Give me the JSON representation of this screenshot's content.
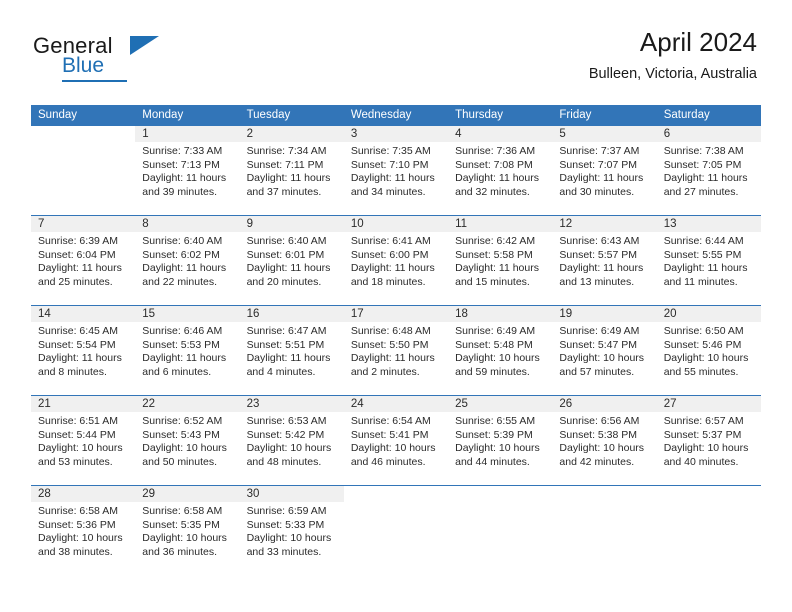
{
  "brand": {
    "line1": "General",
    "line2": "Blue",
    "accent_color": "#1f6fb4",
    "logo_icon": "triangle-flag-icon"
  },
  "header": {
    "title": "April 2024",
    "location": "Bulleen, Victoria, Australia"
  },
  "calendar": {
    "header_color": "#3275b8",
    "daynum_band_color": "#f0f0f0",
    "weekday_headers": [
      "Sunday",
      "Monday",
      "Tuesday",
      "Wednesday",
      "Thursday",
      "Friday",
      "Saturday"
    ],
    "labels": {
      "sunrise": "Sunrise:",
      "sunset": "Sunset:",
      "daylight": "Daylight:"
    },
    "weeks": [
      [
        {
          "day": "",
          "sunrise": "",
          "sunset": "",
          "daylight_line1": "",
          "daylight_line2": "",
          "blank": true
        },
        {
          "day": "1",
          "sunrise": "Sunrise: 7:33 AM",
          "sunset": "Sunset: 7:13 PM",
          "daylight_line1": "Daylight: 11 hours",
          "daylight_line2": "and 39 minutes."
        },
        {
          "day": "2",
          "sunrise": "Sunrise: 7:34 AM",
          "sunset": "Sunset: 7:11 PM",
          "daylight_line1": "Daylight: 11 hours",
          "daylight_line2": "and 37 minutes."
        },
        {
          "day": "3",
          "sunrise": "Sunrise: 7:35 AM",
          "sunset": "Sunset: 7:10 PM",
          "daylight_line1": "Daylight: 11 hours",
          "daylight_line2": "and 34 minutes."
        },
        {
          "day": "4",
          "sunrise": "Sunrise: 7:36 AM",
          "sunset": "Sunset: 7:08 PM",
          "daylight_line1": "Daylight: 11 hours",
          "daylight_line2": "and 32 minutes."
        },
        {
          "day": "5",
          "sunrise": "Sunrise: 7:37 AM",
          "sunset": "Sunset: 7:07 PM",
          "daylight_line1": "Daylight: 11 hours",
          "daylight_line2": "and 30 minutes."
        },
        {
          "day": "6",
          "sunrise": "Sunrise: 7:38 AM",
          "sunset": "Sunset: 7:05 PM",
          "daylight_line1": "Daylight: 11 hours",
          "daylight_line2": "and 27 minutes."
        }
      ],
      [
        {
          "day": "7",
          "sunrise": "Sunrise: 6:39 AM",
          "sunset": "Sunset: 6:04 PM",
          "daylight_line1": "Daylight: 11 hours",
          "daylight_line2": "and 25 minutes."
        },
        {
          "day": "8",
          "sunrise": "Sunrise: 6:40 AM",
          "sunset": "Sunset: 6:02 PM",
          "daylight_line1": "Daylight: 11 hours",
          "daylight_line2": "and 22 minutes."
        },
        {
          "day": "9",
          "sunrise": "Sunrise: 6:40 AM",
          "sunset": "Sunset: 6:01 PM",
          "daylight_line1": "Daylight: 11 hours",
          "daylight_line2": "and 20 minutes."
        },
        {
          "day": "10",
          "sunrise": "Sunrise: 6:41 AM",
          "sunset": "Sunset: 6:00 PM",
          "daylight_line1": "Daylight: 11 hours",
          "daylight_line2": "and 18 minutes."
        },
        {
          "day": "11",
          "sunrise": "Sunrise: 6:42 AM",
          "sunset": "Sunset: 5:58 PM",
          "daylight_line1": "Daylight: 11 hours",
          "daylight_line2": "and 15 minutes."
        },
        {
          "day": "12",
          "sunrise": "Sunrise: 6:43 AM",
          "sunset": "Sunset: 5:57 PM",
          "daylight_line1": "Daylight: 11 hours",
          "daylight_line2": "and 13 minutes."
        },
        {
          "day": "13",
          "sunrise": "Sunrise: 6:44 AM",
          "sunset": "Sunset: 5:55 PM",
          "daylight_line1": "Daylight: 11 hours",
          "daylight_line2": "and 11 minutes."
        }
      ],
      [
        {
          "day": "14",
          "sunrise": "Sunrise: 6:45 AM",
          "sunset": "Sunset: 5:54 PM",
          "daylight_line1": "Daylight: 11 hours",
          "daylight_line2": "and 8 minutes."
        },
        {
          "day": "15",
          "sunrise": "Sunrise: 6:46 AM",
          "sunset": "Sunset: 5:53 PM",
          "daylight_line1": "Daylight: 11 hours",
          "daylight_line2": "and 6 minutes."
        },
        {
          "day": "16",
          "sunrise": "Sunrise: 6:47 AM",
          "sunset": "Sunset: 5:51 PM",
          "daylight_line1": "Daylight: 11 hours",
          "daylight_line2": "and 4 minutes."
        },
        {
          "day": "17",
          "sunrise": "Sunrise: 6:48 AM",
          "sunset": "Sunset: 5:50 PM",
          "daylight_line1": "Daylight: 11 hours",
          "daylight_line2": "and 2 minutes."
        },
        {
          "day": "18",
          "sunrise": "Sunrise: 6:49 AM",
          "sunset": "Sunset: 5:48 PM",
          "daylight_line1": "Daylight: 10 hours",
          "daylight_line2": "and 59 minutes."
        },
        {
          "day": "19",
          "sunrise": "Sunrise: 6:49 AM",
          "sunset": "Sunset: 5:47 PM",
          "daylight_line1": "Daylight: 10 hours",
          "daylight_line2": "and 57 minutes."
        },
        {
          "day": "20",
          "sunrise": "Sunrise: 6:50 AM",
          "sunset": "Sunset: 5:46 PM",
          "daylight_line1": "Daylight: 10 hours",
          "daylight_line2": "and 55 minutes."
        }
      ],
      [
        {
          "day": "21",
          "sunrise": "Sunrise: 6:51 AM",
          "sunset": "Sunset: 5:44 PM",
          "daylight_line1": "Daylight: 10 hours",
          "daylight_line2": "and 53 minutes."
        },
        {
          "day": "22",
          "sunrise": "Sunrise: 6:52 AM",
          "sunset": "Sunset: 5:43 PM",
          "daylight_line1": "Daylight: 10 hours",
          "daylight_line2": "and 50 minutes."
        },
        {
          "day": "23",
          "sunrise": "Sunrise: 6:53 AM",
          "sunset": "Sunset: 5:42 PM",
          "daylight_line1": "Daylight: 10 hours",
          "daylight_line2": "and 48 minutes."
        },
        {
          "day": "24",
          "sunrise": "Sunrise: 6:54 AM",
          "sunset": "Sunset: 5:41 PM",
          "daylight_line1": "Daylight: 10 hours",
          "daylight_line2": "and 46 minutes."
        },
        {
          "day": "25",
          "sunrise": "Sunrise: 6:55 AM",
          "sunset": "Sunset: 5:39 PM",
          "daylight_line1": "Daylight: 10 hours",
          "daylight_line2": "and 44 minutes."
        },
        {
          "day": "26",
          "sunrise": "Sunrise: 6:56 AM",
          "sunset": "Sunset: 5:38 PM",
          "daylight_line1": "Daylight: 10 hours",
          "daylight_line2": "and 42 minutes."
        },
        {
          "day": "27",
          "sunrise": "Sunrise: 6:57 AM",
          "sunset": "Sunset: 5:37 PM",
          "daylight_line1": "Daylight: 10 hours",
          "daylight_line2": "and 40 minutes."
        }
      ],
      [
        {
          "day": "28",
          "sunrise": "Sunrise: 6:58 AM",
          "sunset": "Sunset: 5:36 PM",
          "daylight_line1": "Daylight: 10 hours",
          "daylight_line2": "and 38 minutes."
        },
        {
          "day": "29",
          "sunrise": "Sunrise: 6:58 AM",
          "sunset": "Sunset: 5:35 PM",
          "daylight_line1": "Daylight: 10 hours",
          "daylight_line2": "and 36 minutes."
        },
        {
          "day": "30",
          "sunrise": "Sunrise: 6:59 AM",
          "sunset": "Sunset: 5:33 PM",
          "daylight_line1": "Daylight: 10 hours",
          "daylight_line2": "and 33 minutes."
        },
        {
          "day": "",
          "sunrise": "",
          "sunset": "",
          "daylight_line1": "",
          "daylight_line2": "",
          "blank": true
        },
        {
          "day": "",
          "sunrise": "",
          "sunset": "",
          "daylight_line1": "",
          "daylight_line2": "",
          "blank": true
        },
        {
          "day": "",
          "sunrise": "",
          "sunset": "",
          "daylight_line1": "",
          "daylight_line2": "",
          "blank": true
        },
        {
          "day": "",
          "sunrise": "",
          "sunset": "",
          "daylight_line1": "",
          "daylight_line2": "",
          "blank": true
        }
      ]
    ]
  }
}
